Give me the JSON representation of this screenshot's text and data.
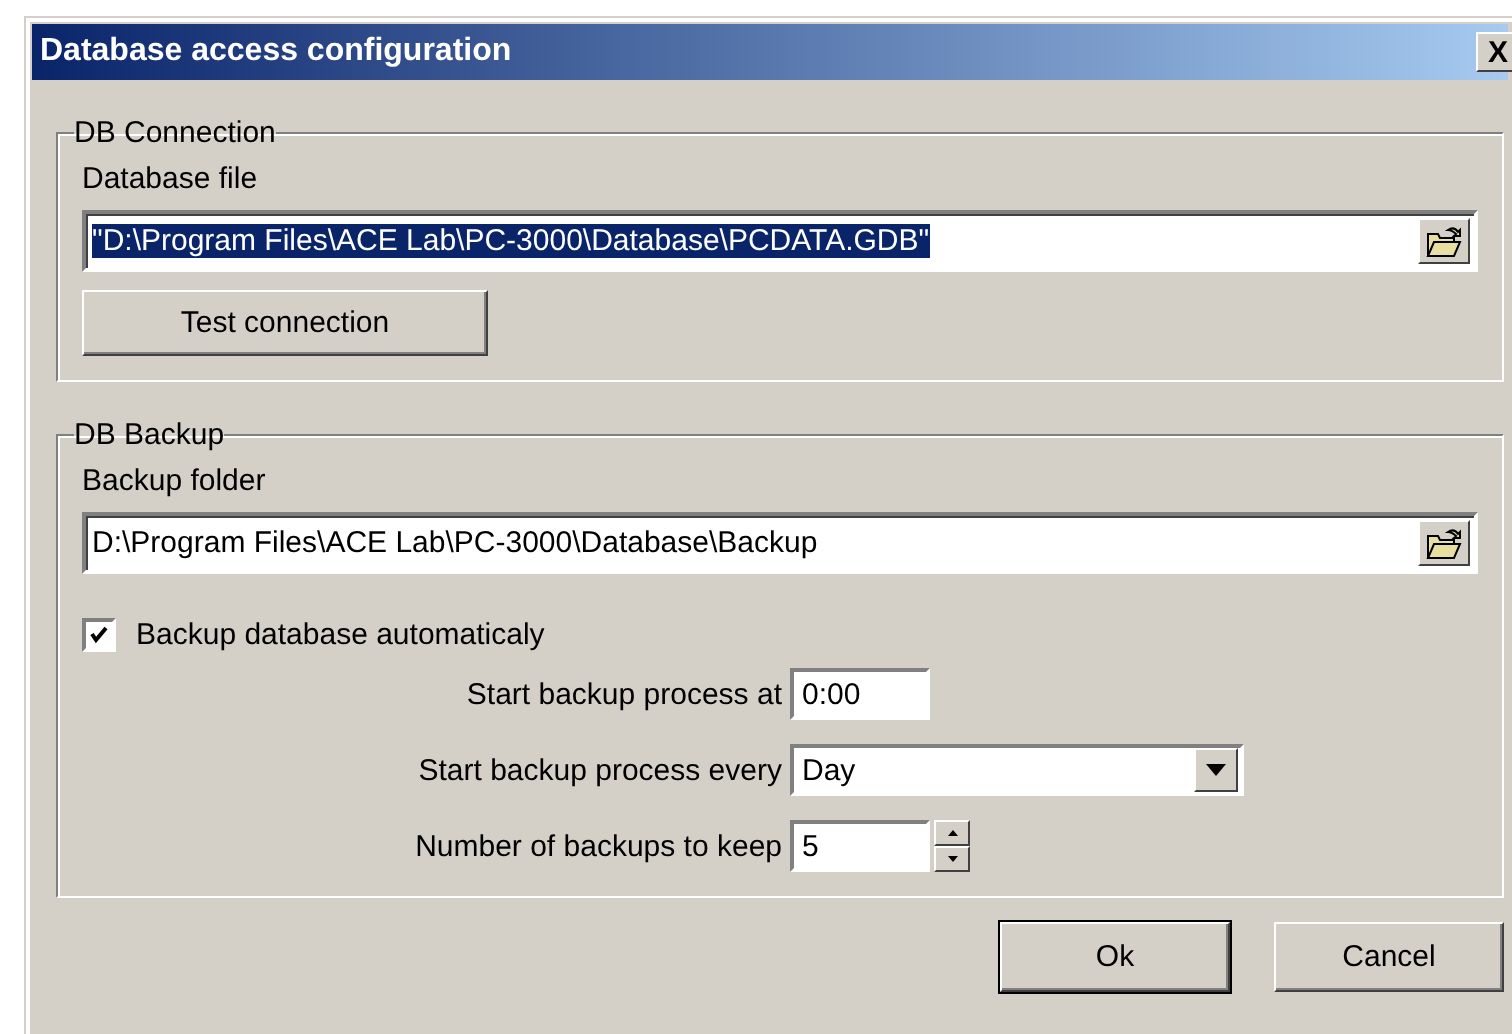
{
  "window": {
    "title": "Database access configuration",
    "close_label": "X"
  },
  "db_connection": {
    "title": "DB Connection",
    "file_label": "Database file",
    "file_value": "\"D:\\Program Files\\ACE Lab\\PC-3000\\Database\\PCDATA.GDB\"",
    "file_value_selected": true,
    "test_button": "Test connection"
  },
  "db_backup": {
    "title": "DB Backup",
    "folder_label": "Backup folder",
    "folder_value": "D:\\Program Files\\ACE Lab\\PC-3000\\Database\\Backup",
    "auto_backup": {
      "label": "Backup database automaticaly",
      "checked": true
    },
    "start_at": {
      "label": "Start backup process at",
      "value": "0:00"
    },
    "every": {
      "label": "Start backup process every",
      "value": "Day"
    },
    "keep": {
      "label": "Number of backups to keep",
      "value": "5"
    }
  },
  "buttons": [
    {
      "label": "Ok",
      "default": true
    },
    {
      "label": "Cancel",
      "default": false
    }
  ]
}
